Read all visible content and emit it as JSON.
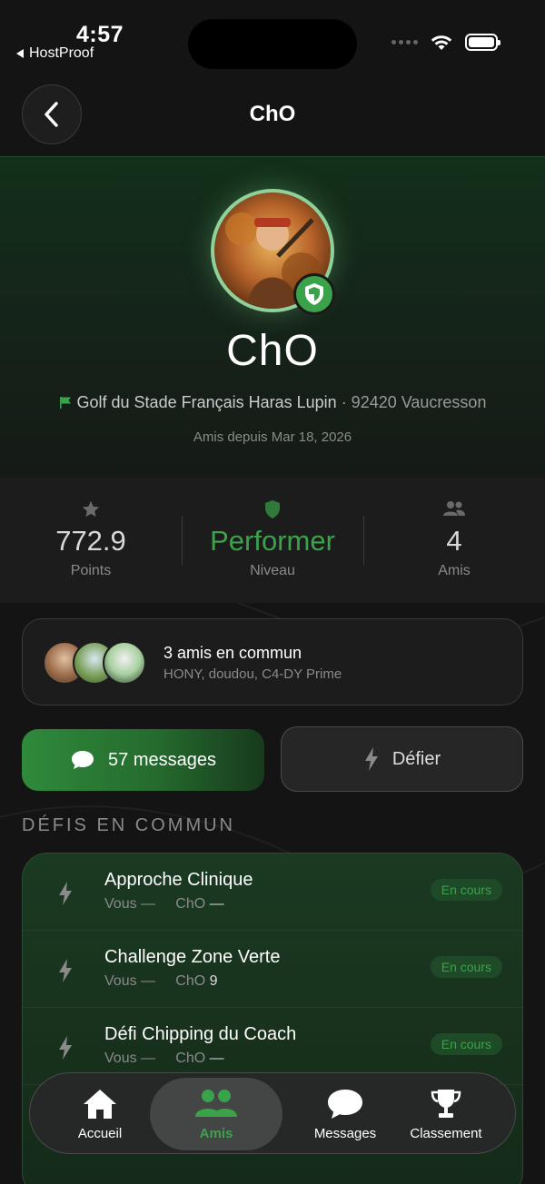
{
  "status_bar": {
    "time": "4:57",
    "back_app": "HostProof"
  },
  "header": {
    "title": "ChO"
  },
  "profile": {
    "name": "ChO",
    "club": "Golf du Stade Français Haras Lupin",
    "location": "· 92420 Vaucresson",
    "friends_since": "Amis depuis Mar 18, 2026"
  },
  "stats": [
    {
      "value": "772.9",
      "label": "Points",
      "icon": "star-icon"
    },
    {
      "value": "Performer",
      "label": "Niveau",
      "icon": "shield-icon"
    },
    {
      "value": "4",
      "label": "Amis",
      "icon": "people-icon"
    }
  ],
  "common_friends": {
    "title": "3 amis en commun",
    "names": "HONY, doudou, C4-DY Prime"
  },
  "actions": {
    "messages_label": "57 messages",
    "challenge_label": "Défier"
  },
  "section": {
    "title": "DÉFIS EN COMMUN"
  },
  "challenges": [
    {
      "title": "Approche Clinique",
      "you_label": "Vous",
      "you_score": "—",
      "them_label": "ChO",
      "them_score": "—",
      "status": "En cours"
    },
    {
      "title": "Challenge Zone Verte",
      "you_label": "Vous",
      "you_score": "—",
      "them_label": "ChO",
      "them_score": "9",
      "status": "En cours"
    },
    {
      "title": "Défi Chipping du Coach",
      "you_label": "Vous",
      "you_score": "—",
      "them_label": "ChO",
      "them_score": "—",
      "status": "En cours"
    }
  ],
  "tab_bar": {
    "items": [
      {
        "label": "Accueil",
        "icon": "home-icon"
      },
      {
        "label": "Amis",
        "icon": "friends-icon"
      },
      {
        "label": "Messages",
        "icon": "chat-icon"
      },
      {
        "label": "Classement",
        "icon": "trophy-icon"
      }
    ]
  },
  "colors": {
    "accent": "#3aa34a",
    "background": "#141414",
    "card": "#1c1c1c"
  }
}
